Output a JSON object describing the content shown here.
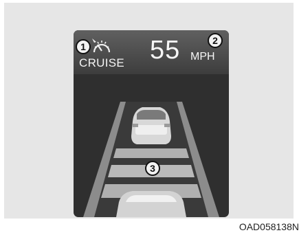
{
  "display": {
    "cruise_label": "CRUISE",
    "speed_value": "55",
    "speed_unit": "MPH"
  },
  "callouts": {
    "one": "1",
    "two": "2",
    "three": "3"
  },
  "caption": "OAD058138N",
  "icons": {
    "cruise": "speedometer-cruise-icon"
  },
  "colors": {
    "screen": "#2f2f2f",
    "road": "#9a9a9a",
    "text": "#f6f6f6"
  }
}
